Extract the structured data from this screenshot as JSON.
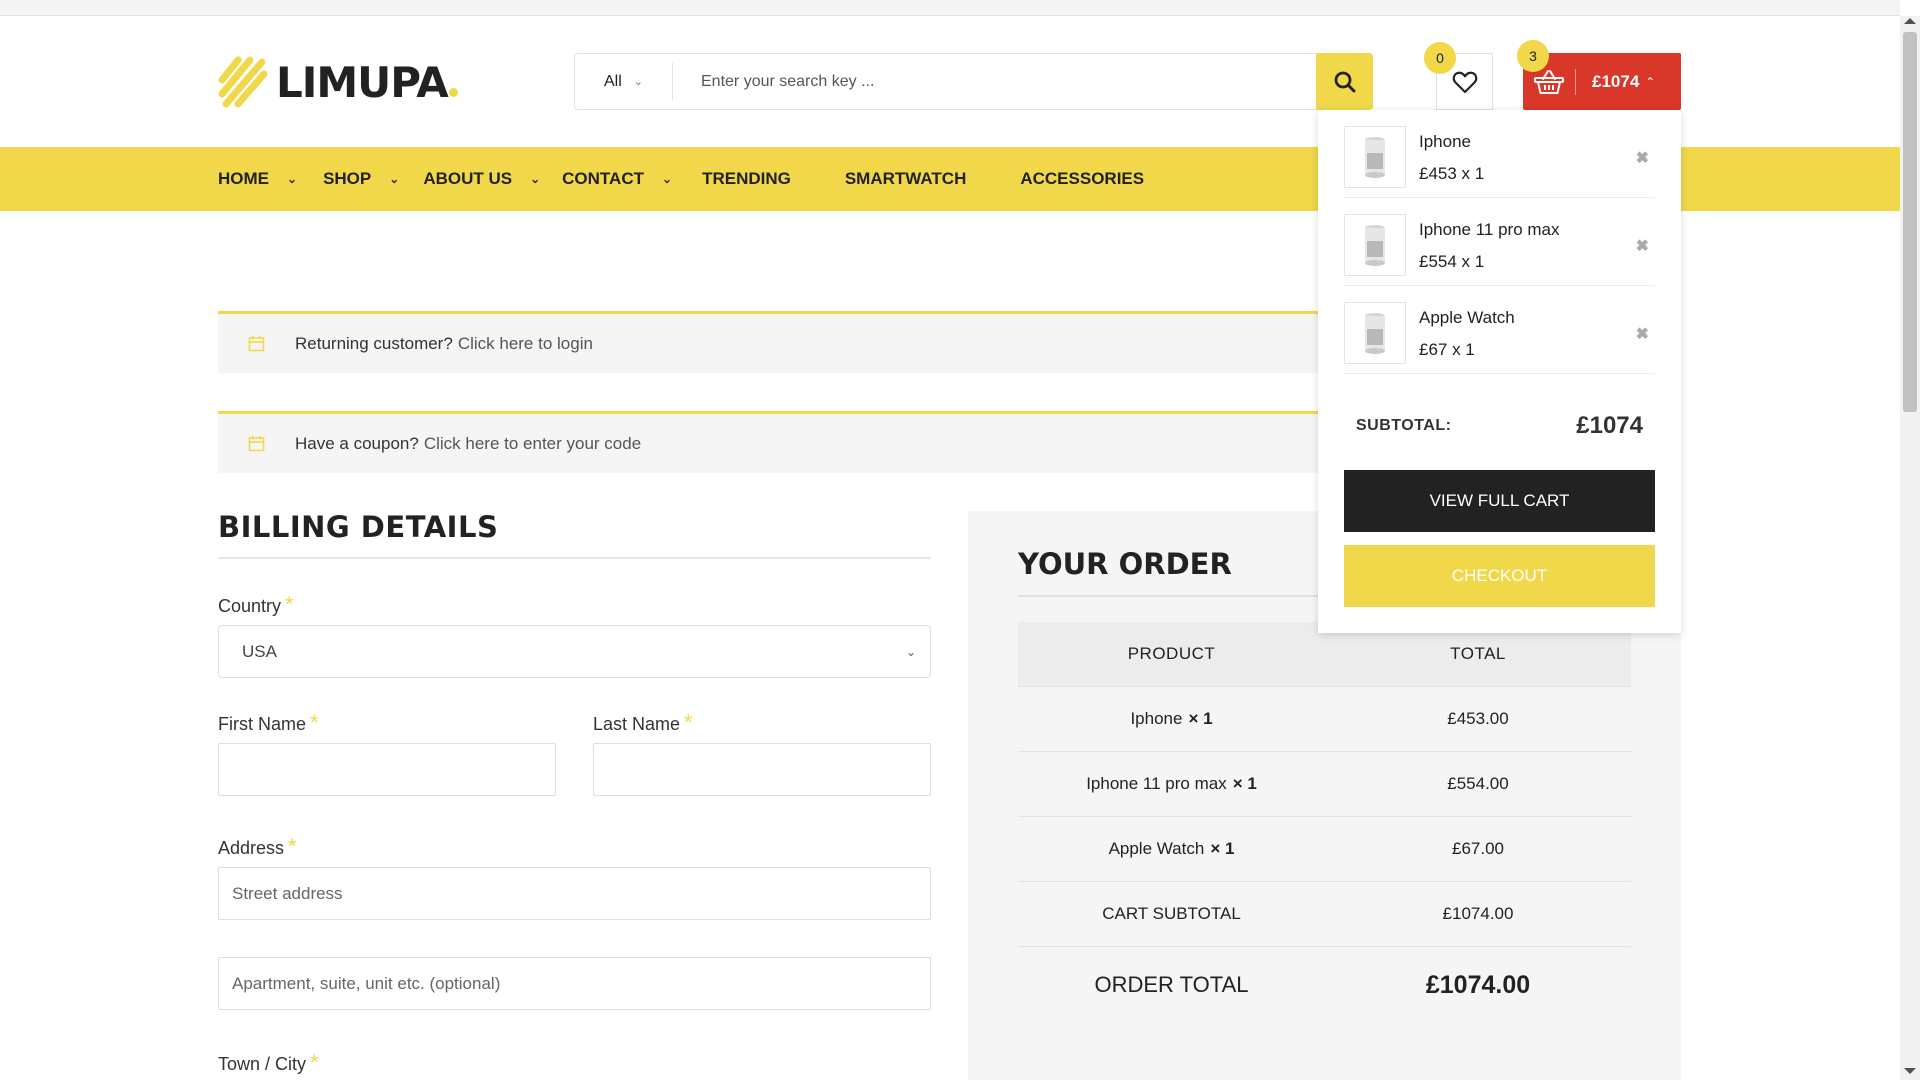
{
  "brand": {
    "name": "LIMUPA"
  },
  "search": {
    "category": "All",
    "placeholder": "Enter your search key ..."
  },
  "wishlist": {
    "count": "0"
  },
  "cart": {
    "count": "3",
    "total": "£1074"
  },
  "nav": {
    "items": [
      {
        "label": "HOME",
        "has_dropdown": true
      },
      {
        "label": "SHOP",
        "has_dropdown": true
      },
      {
        "label": "ABOUT US",
        "has_dropdown": true
      },
      {
        "label": "CONTACT",
        "has_dropdown": true
      },
      {
        "label": "TRENDING",
        "has_dropdown": false
      },
      {
        "label": "SMARTWATCH",
        "has_dropdown": false
      },
      {
        "label": "ACCESSORIES",
        "has_dropdown": false
      }
    ]
  },
  "notices": {
    "login": {
      "text": "Returning customer?",
      "link": "Click here to login"
    },
    "coupon": {
      "text": "Have a coupon?",
      "link": "Click here to enter your code"
    }
  },
  "billing": {
    "title": "BILLING DETAILS",
    "country_label": "Country",
    "country_value": "USA",
    "first_name_label": "First Name",
    "last_name_label": "Last Name",
    "address_label": "Address",
    "street_placeholder": "Street address",
    "apartment_placeholder": "Apartment, suite, unit etc. (optional)",
    "town_label": "Town / City",
    "required_mark": "*"
  },
  "order": {
    "title": "YOUR ORDER",
    "head_product": "PRODUCT",
    "head_total": "TOTAL",
    "items": [
      {
        "name": "Iphone",
        "qty": "× 1",
        "total": "£453.00"
      },
      {
        "name": "Iphone 11 pro max",
        "qty": "× 1",
        "total": "£554.00"
      },
      {
        "name": "Apple Watch",
        "qty": "× 1",
        "total": "£67.00"
      }
    ],
    "subtotal_label": "CART SUBTOTAL",
    "subtotal_value": "£1074.00",
    "total_label": "ORDER TOTAL",
    "total_value": "£1074.00"
  },
  "mini_cart": {
    "items": [
      {
        "name": "Iphone",
        "price": "£453 x 1"
      },
      {
        "name": "Iphone 11 pro max",
        "price": "£554 x 1"
      },
      {
        "name": "Apple Watch",
        "price": "£67 x 1"
      }
    ],
    "subtotal_label": "SUBTOTAL:",
    "subtotal_value": "£1074",
    "view_cart_label": "VIEW FULL CART",
    "checkout_label": "CHECKOUT"
  },
  "colors": {
    "accent": "#f0d84a",
    "cart": "#d9372a",
    "dark": "#222222"
  }
}
